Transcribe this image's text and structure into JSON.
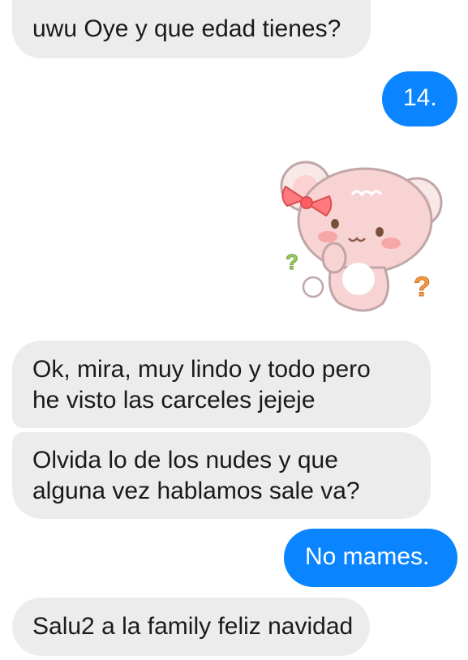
{
  "messages": [
    {
      "id": "m1",
      "from": "incoming",
      "lines": [
        "uwu Oye y que edad tienes?"
      ]
    },
    {
      "id": "m2",
      "from": "outgoing",
      "lines": [
        "14."
      ]
    },
    {
      "id": "m3",
      "from": "incoming",
      "lines": [
        "Ok, mira, muy lindo y todo pero",
        "he visto las carceles jejeje"
      ]
    },
    {
      "id": "m4",
      "from": "incoming",
      "lines": [
        "Olvida lo de los nudes y que",
        "alguna vez hablamos sale va?"
      ]
    },
    {
      "id": "m5",
      "from": "outgoing",
      "lines": [
        "No mames."
      ]
    },
    {
      "id": "m6",
      "from": "incoming",
      "lines": [
        "Salu2 a la family feliz navidad"
      ]
    }
  ],
  "sticker": {
    "icon": "bear-with-bow-sticker-icon",
    "colors": {
      "body": "#f8d3d4",
      "outline": "#c0a6a8",
      "bow": "#ff6b6e",
      "question_green": "#9fce63",
      "question_orange": "#f39a45"
    }
  },
  "colors": {
    "incoming_bubble": "#ececec",
    "outgoing_bubble": "#0a84ff",
    "incoming_text": "#1a1a1a",
    "outgoing_text": "#ffffff"
  }
}
